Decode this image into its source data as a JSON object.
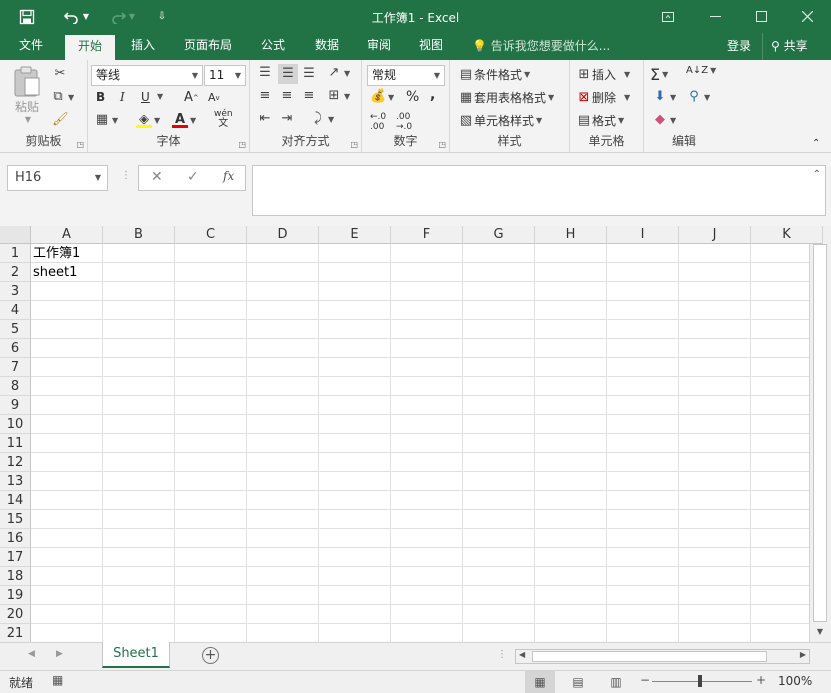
{
  "title_bar": {
    "title": "工作簿1 - Excel",
    "save_icon": "save-icon",
    "undo_icon": "undo-icon",
    "redo_icon": "redo-icon",
    "customize_icon": "customize-toolbar-icon"
  },
  "tabs": [
    {
      "label": "文件"
    },
    {
      "label": "开始",
      "active": true
    },
    {
      "label": "插入"
    },
    {
      "label": "页面布局"
    },
    {
      "label": "公式"
    },
    {
      "label": "数据"
    },
    {
      "label": "审阅"
    },
    {
      "label": "视图"
    }
  ],
  "tell_me": "告诉我您想要做什么...",
  "login": "登录",
  "share": "共享",
  "ribbon": {
    "clipboard": {
      "label": "剪贴板",
      "paste": "粘贴"
    },
    "font": {
      "label": "字体",
      "font_name": "等线",
      "font_size": "11",
      "bold": "B",
      "italic": "I",
      "underline": "U",
      "phonetic": "wén"
    },
    "alignment": {
      "label": "对齐方式"
    },
    "number": {
      "label": "数字",
      "format": "常规",
      "percent": "%",
      "comma": ","
    },
    "styles": {
      "label": "样式",
      "conditional": "条件格式",
      "table": "套用表格格式",
      "cell_styles": "单元格样式"
    },
    "cells": {
      "label": "单元格",
      "insert": "插入",
      "delete": "删除",
      "format": "格式"
    },
    "editing": {
      "label": "编辑"
    }
  },
  "formula_bar": {
    "name_box": "H16",
    "fx": "fx",
    "formula": ""
  },
  "columns": [
    "A",
    "B",
    "C",
    "D",
    "E",
    "F",
    "G",
    "H",
    "I",
    "J",
    "K"
  ],
  "rows": [
    "1",
    "2",
    "3",
    "4",
    "5",
    "6",
    "7",
    "8",
    "9",
    "10",
    "11",
    "12",
    "13",
    "14",
    "15",
    "16",
    "17",
    "18",
    "19",
    "20",
    "21"
  ],
  "cells": {
    "A1": "工作簿1",
    "A2": "sheet1"
  },
  "sheets": [
    {
      "name": "Sheet1",
      "active": true
    }
  ],
  "status": {
    "ready": "就绪",
    "zoom": "100%"
  },
  "colors": {
    "brand": "#217346",
    "ribbon_bg": "#f3f3f3"
  }
}
